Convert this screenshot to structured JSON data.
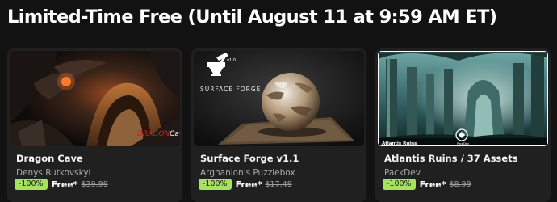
{
  "heading": "Limited-Time Free (Until August 11 at 9:59 AM ET)",
  "colors": {
    "background": "#121212",
    "card": "#202020",
    "discount_badge": "#a7e063"
  },
  "cards": [
    {
      "title": "Dragon Cave",
      "publisher": "Denys Rutkovskyi",
      "discount": "-100%",
      "price": "Free*",
      "original_price": "$39.99",
      "thumb_overlay": {
        "part1": "DRAGON",
        "part2": "Cave"
      }
    },
    {
      "title": "Surface Forge v1.1",
      "publisher": "Arghanion's Puzzlebox",
      "discount": "-100%",
      "price": "Free*",
      "original_price": "$17.49",
      "thumb_overlay": {
        "brand": "SURFACE FORGE",
        "version": "v1.0"
      }
    },
    {
      "title": "Atlantis Ruins / 37 Assets",
      "publisher": "PackDev",
      "discount": "-100%",
      "price": "Free*",
      "original_price": "$8.99",
      "thumb_overlay": {
        "caption": "Atlantis Ruins",
        "logo": "PackDev"
      }
    }
  ]
}
